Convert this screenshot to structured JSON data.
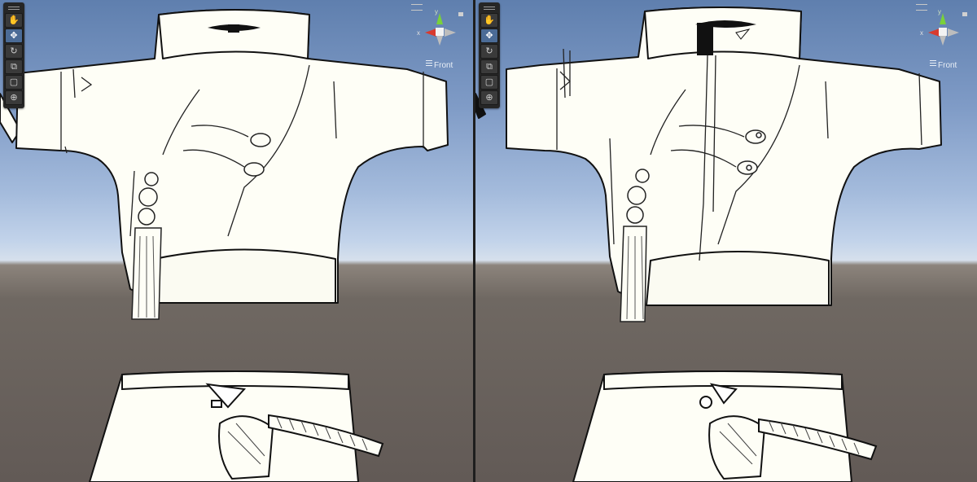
{
  "viewports": [
    {
      "id": "left",
      "orientation_label": "Front",
      "axis_x_label": "x",
      "axis_y_label": "y",
      "tools": [
        "hand-tool",
        "move-tool",
        "rotate-tool",
        "scale-tool",
        "rect-tool",
        "transform-tool"
      ],
      "active_tool": "move-tool"
    },
    {
      "id": "right",
      "orientation_label": "Front",
      "axis_x_label": "x",
      "axis_y_label": "y",
      "tools": [
        "hand-tool",
        "move-tool",
        "rotate-tool",
        "scale-tool",
        "rect-tool",
        "transform-tool"
      ],
      "active_tool": "move-tool"
    }
  ],
  "colors": {
    "sky_top": "#5f7fae",
    "horizon": "#d6e0ec",
    "ground": "#625a56",
    "garment_fill": "#fefef6",
    "outline": "#111111",
    "gizmo_x": "#d83a2e",
    "gizmo_y": "#7ad13a",
    "active_tool": "#4b6b96"
  }
}
